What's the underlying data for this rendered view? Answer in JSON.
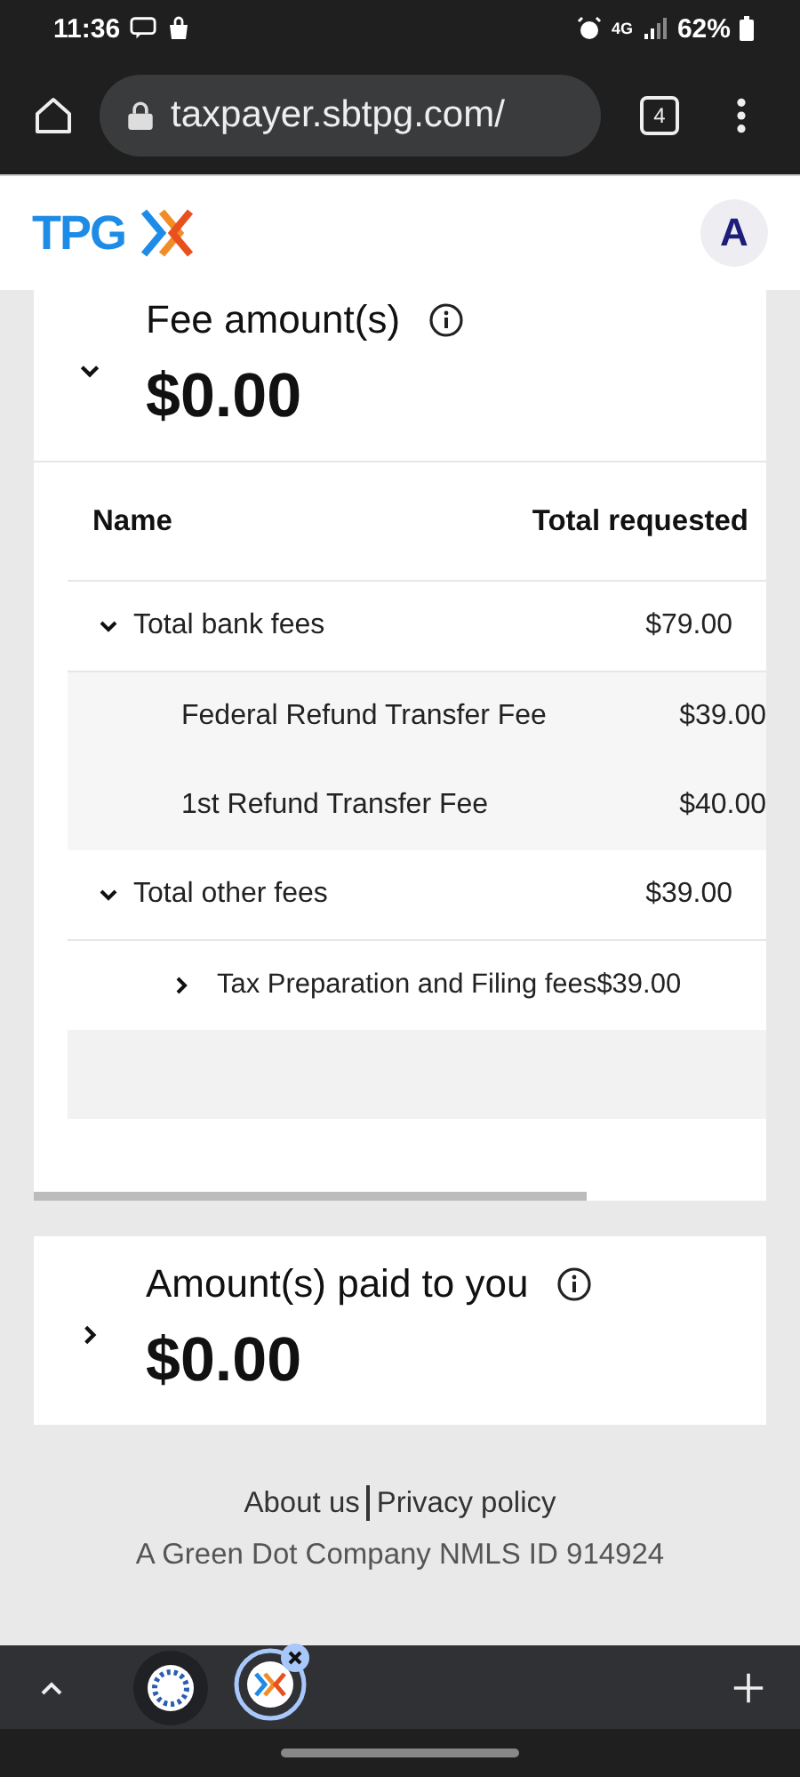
{
  "status_bar": {
    "time": "11:36",
    "network": "4G",
    "battery": "62%"
  },
  "browser": {
    "url": "taxpayer.sbtpg.com/",
    "tab_count": "4"
  },
  "header": {
    "logo_text": "TPG",
    "avatar": "A"
  },
  "fee_section": {
    "title": "Fee amount(s)",
    "amount": "$0.00",
    "expanded": true
  },
  "table": {
    "columns": [
      "Name",
      "Total requested"
    ],
    "rows": [
      {
        "name": "Total bank fees",
        "amount": "$79.00",
        "expanded": true,
        "children": [
          {
            "name": "Federal Refund Transfer Fee",
            "amount": "$39.00"
          },
          {
            "name": "1st Refund Transfer Fee",
            "amount": "$40.00"
          }
        ]
      },
      {
        "name": "Total other fees",
        "amount": "$39.00",
        "expanded": true,
        "children": [
          {
            "name": "Tax Preparation and Filing fees",
            "amount": "$39.00",
            "expanded": false
          }
        ]
      }
    ]
  },
  "paid_section": {
    "title": "Amount(s) paid to you",
    "amount": "$0.00",
    "expanded": false
  },
  "footer": {
    "links": [
      "About us",
      "Privacy policy"
    ],
    "note": "A Green Dot Company NMLS ID 914924"
  }
}
